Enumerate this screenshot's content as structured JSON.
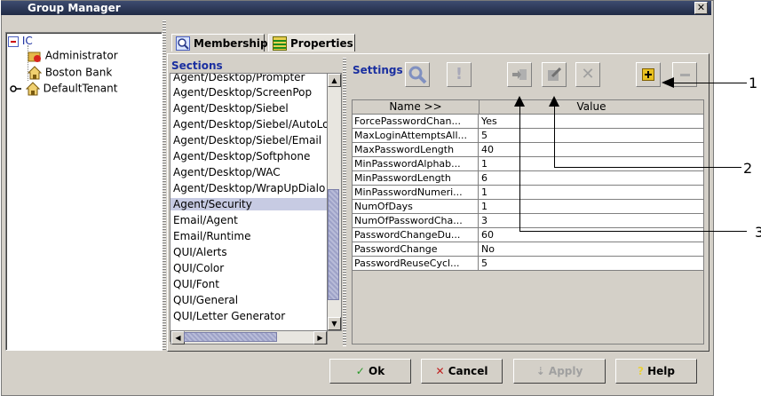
{
  "window": {
    "title": "Group Manager",
    "close_glyph": "✕"
  },
  "tree": {
    "root": "IC",
    "items": [
      "Administrator",
      "Boston Bank",
      "DefaultTenant"
    ]
  },
  "tabs": [
    {
      "label": "Membership",
      "icon": "magnifier-icon"
    },
    {
      "label": "Properties",
      "icon": "properties-grid-icon"
    }
  ],
  "sections": {
    "label": "Sections",
    "items": [
      "Agent/Desktop/Prompter",
      "Agent/Desktop/ScreenPop",
      "Agent/Desktop/Siebel",
      "Agent/Desktop/Siebel/AutoLo",
      "Agent/Desktop/Siebel/Email",
      "Agent/Desktop/Softphone",
      "Agent/Desktop/WAC",
      "Agent/Desktop/WrapUpDialo",
      "Agent/Security",
      "Email/Agent",
      "Email/Runtime",
      "QUI/Alerts",
      "QUI/Color",
      "QUI/Font",
      "QUI/General",
      "QUI/Letter Generator"
    ],
    "selected": "Agent/Security"
  },
  "settings": {
    "label": "Settings",
    "toolbar": [
      "search-icon",
      "exclamation-icon",
      "import-icon",
      "edit-icon",
      "delete-icon",
      "add-icon",
      "remove-icon"
    ],
    "columns": {
      "name": "Name >>",
      "value": "Value"
    },
    "rows": [
      {
        "name": "ForcePasswordChan...",
        "value": "Yes"
      },
      {
        "name": "MaxLoginAttemptsAll...",
        "value": "5"
      },
      {
        "name": "MaxPasswordLength",
        "value": "40"
      },
      {
        "name": "MinPasswordAlphab...",
        "value": "1"
      },
      {
        "name": "MinPasswordLength",
        "value": "6"
      },
      {
        "name": "MinPasswordNumeri...",
        "value": "1"
      },
      {
        "name": "NumOfDays",
        "value": "1"
      },
      {
        "name": "NumOfPasswordCha...",
        "value": "3"
      },
      {
        "name": "PasswordChangeDu...",
        "value": "60"
      },
      {
        "name": "PasswordChange",
        "value": "No"
      },
      {
        "name": "PasswordReuseCycl...",
        "value": "5"
      }
    ]
  },
  "buttons": {
    "ok": "Ok",
    "cancel": "Cancel",
    "apply": "Apply",
    "help": "Help"
  },
  "callouts": [
    "1",
    "2",
    "3"
  ],
  "colors": {
    "accent": "#1a2fa0",
    "selection": "#c7cbe3",
    "title_bg": "#2a3557"
  }
}
